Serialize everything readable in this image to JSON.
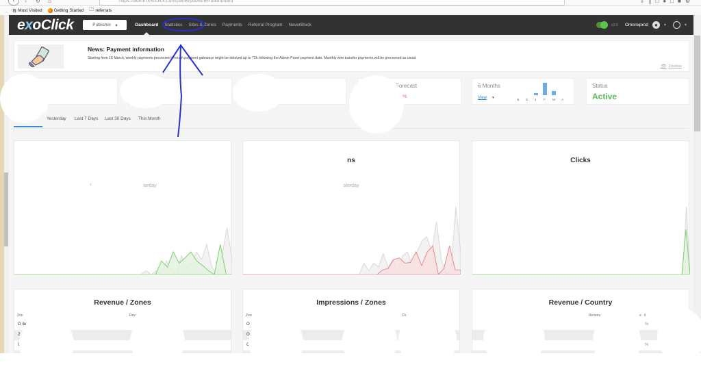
{
  "browser": {
    "url": "https://admin.exoclick.com/panel/publisher/dashboard",
    "bookmarks": [
      {
        "icon": "gear-icon",
        "label": "Most Visited"
      },
      {
        "icon": "firefox-icon",
        "label": "Getting Started"
      },
      {
        "icon": "folder-icon",
        "label": "referrals"
      }
    ]
  },
  "nav": {
    "logo_prefix": "e",
    "logo_x": "x",
    "logo_suffix": "oClick",
    "role_selector": "Publisher",
    "links": [
      "Dashboard",
      "Statistics",
      "Sites & Zones",
      "Payments",
      "Referral Program",
      "NeverBlock"
    ],
    "active_link": "Dashboard",
    "version": "v2.0",
    "username": "Omenxprod"
  },
  "news": {
    "title": "News: Payment information",
    "text": "Starting from 16 March, weekly payments processed through payment gateways might be delayed up to 72h following the Admin Panel payment date. Monthly wire transfer payments will be processed as usual.",
    "dismiss": "Dismiss"
  },
  "stats": {
    "forecast": {
      "label": "Forecast",
      "value": "%"
    },
    "six_months": {
      "label": "6 Months",
      "view": "View",
      "months": [
        "N",
        "D",
        "J",
        "F",
        "M",
        "A"
      ],
      "values": [
        0,
        0,
        0.15,
        1.0,
        0.35,
        0
      ]
    },
    "status": {
      "label": "Status",
      "value": "Active"
    }
  },
  "date_tabs": [
    "",
    "Yesterday",
    "Last 7 Days",
    "Last 30 Days",
    "This Month"
  ],
  "charts": [
    {
      "title": "",
      "subtitle": "terday",
      "trend": "up",
      "color": "#7ccf6c",
      "fill": "#e2f3df",
      "series_current": [
        0,
        0,
        0,
        0,
        0,
        0,
        0,
        0,
        0,
        0,
        0,
        0,
        0,
        0,
        0,
        0,
        0,
        0,
        0,
        0,
        0,
        0,
        0,
        0,
        0,
        0.18,
        0.1,
        0.3,
        0.15,
        0.22,
        0.3,
        0.18,
        0.12,
        0.05,
        0,
        0.4,
        0,
        0
      ],
      "series_prev": [
        0,
        0,
        0,
        0,
        0,
        0,
        0,
        0,
        0,
        0,
        0,
        0,
        0,
        0,
        0,
        0,
        0,
        0,
        0,
        0,
        0,
        0,
        0,
        0,
        0,
        0,
        0.05,
        0,
        0.05,
        0.02,
        0.18,
        0.05,
        0,
        0.25,
        0.1,
        0.15,
        0.3,
        0.2,
        0.4,
        0.1,
        0,
        0.25,
        0.62,
        0.2
      ]
    },
    {
      "title": "ns",
      "subtitle": "sterday",
      "trend": "",
      "color": "#e88a8a",
      "fill": "#f7dede",
      "series_current": [
        0,
        0,
        0,
        0,
        0,
        0,
        0,
        0,
        0,
        0,
        0,
        0,
        0,
        0,
        0,
        0,
        0,
        0,
        0,
        0,
        0,
        0,
        0,
        0,
        0,
        0.06,
        0.08,
        0.2,
        0.22,
        0.15,
        0.16,
        0.3,
        0.12,
        0.3,
        0.38,
        0,
        0.08,
        0.38,
        0.06,
        0.06
      ],
      "series_prev": [
        0,
        0,
        0,
        0,
        0,
        0,
        0,
        0,
        0,
        0,
        0,
        0,
        0,
        0,
        0,
        0,
        0,
        0,
        0,
        0,
        0,
        0,
        0,
        0,
        0,
        0.15,
        0.05,
        0.15,
        0.1,
        0.28,
        0.1,
        0.2,
        0.05,
        0.25,
        0.3,
        0.1,
        0.3,
        0.45,
        0.5,
        0.3,
        0.7,
        0.2,
        0,
        0.1,
        0.9,
        0.3
      ]
    },
    {
      "title": "Clicks",
      "subtitle": "",
      "trend": "",
      "color": "#7ccf6c",
      "fill": "#e2f3df",
      "series_current": [
        0,
        0,
        0,
        0,
        0,
        0,
        0,
        0,
        0,
        0,
        0,
        0,
        0,
        0,
        0,
        0,
        0,
        0,
        0,
        0,
        0,
        0,
        0,
        0,
        0,
        0,
        0,
        0,
        0,
        0,
        0,
        0,
        0,
        0,
        0,
        0,
        0,
        0,
        0,
        0,
        0,
        0,
        0,
        0,
        0,
        0,
        0,
        0,
        0,
        0,
        0,
        0,
        0.6,
        0
      ],
      "series_prev": [
        0,
        0,
        0,
        0,
        0,
        0,
        0,
        0,
        0,
        0,
        0,
        0,
        0,
        0,
        0,
        0,
        0,
        0,
        0,
        0,
        0,
        0,
        0,
        0,
        0,
        0,
        0,
        0,
        0,
        0,
        0,
        0,
        0,
        0,
        0,
        0,
        0,
        0,
        0,
        0,
        0,
        0,
        0,
        0,
        0,
        0,
        0,
        0,
        0,
        0,
        0,
        0,
        0,
        0,
        0,
        0,
        0,
        0,
        0.9,
        0
      ]
    }
  ],
  "tables": [
    {
      "title": "Revenue / Zones",
      "col1": "Zon",
      "col2": "Rev",
      "rows": [
        "O   ile",
        "2",
        "O"
      ]
    },
    {
      "title": "Impressions / Zones",
      "col1": "Zon",
      "col2": "Ch",
      "rows": [
        "O",
        "O",
        "On   ile"
      ]
    },
    {
      "title": "Revenue / Country",
      "col1": "",
      "col2": "Revenu",
      "col3": "e",
      "rows": [
        "%",
        "",
        "%"
      ]
    }
  ]
}
